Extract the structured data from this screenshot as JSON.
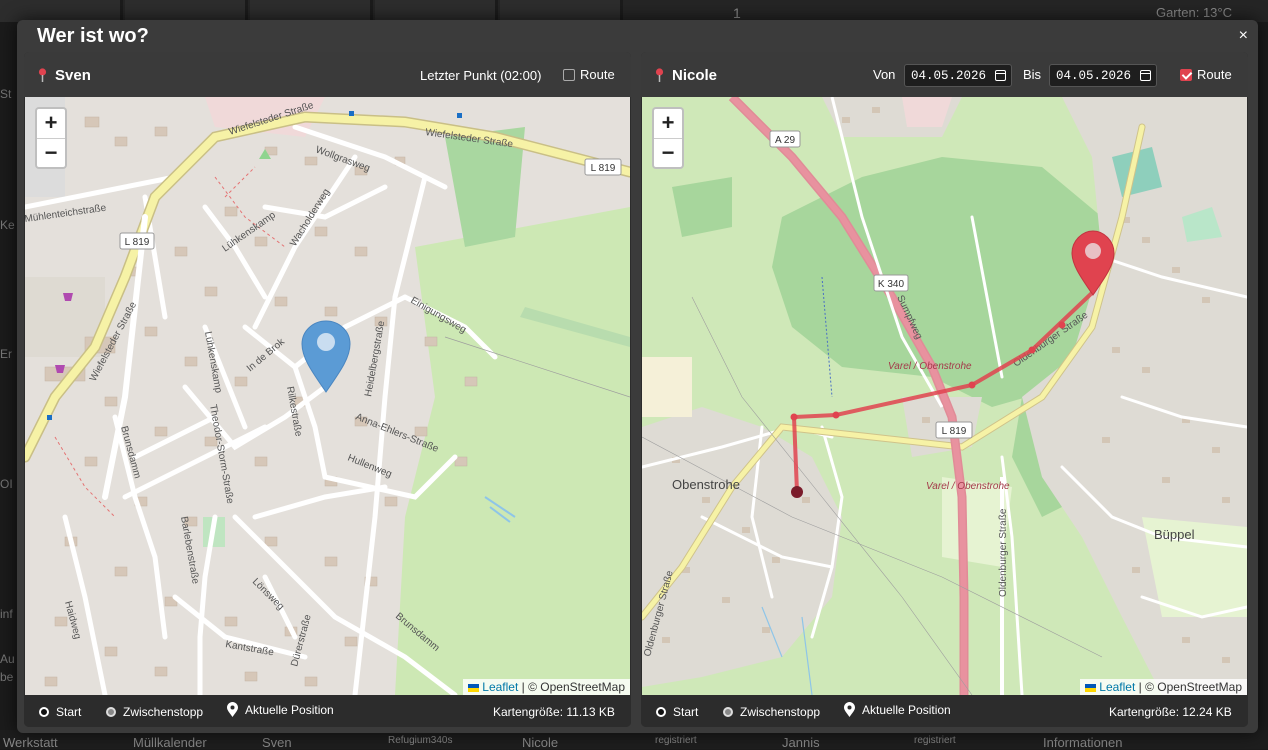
{
  "background": {
    "garden_label": "Garten:",
    "garden_temp": "13°C",
    "badge_count": "1",
    "left_fragments": [
      "St",
      "Ke",
      "Er",
      "OI",
      "inf",
      "Au",
      "be"
    ],
    "bottom_bar": [
      "Werkstatt",
      "Müllkalender",
      "Sven",
      "Refugium340s",
      "Nicole",
      "registriert",
      "Jannis",
      "registriert",
      "Informationen"
    ]
  },
  "modal": {
    "title": "Wer ist wo?",
    "close_symbol": "×"
  },
  "panels": [
    {
      "name": "Sven",
      "last_point": "Letzter Punkt (02:00)",
      "route_label": "Route",
      "route_checked": false,
      "map": {
        "streets": [
          "Wiefelsteder Straße",
          "Wiefelsteder Straße",
          "L 819",
          "L 819",
          "Wiefelsteder Straße",
          "Wollgrasweg",
          "Wacholderweg",
          "Lühkenskamp",
          "Lühkenskamp",
          "Mühlenteichstraße",
          "Einigungsweg",
          "Heidelbergstraße",
          "In de Brok",
          "Rilkestraße",
          "Anna-Ehlers-Straße",
          "Hullenweg",
          "Theodor-Storm-Straße",
          "Brunsdamm",
          "Barlebenstraße",
          "Lönsweg",
          "Dürerstraße",
          "Brunsdamm",
          "Kantstraße",
          "Haidweg"
        ],
        "marker_color": "#5b9bd5"
      },
      "attribution": {
        "leaflet": "Leaflet",
        "rest": "| © OpenStreetMap"
      },
      "footer": {
        "start": "Start",
        "mid": "Zwischenstopp",
        "current": "Aktuelle Position",
        "size": "Kartengröße: 11.13 KB"
      }
    },
    {
      "name": "Nicole",
      "from_label": "Von",
      "from_value": "04.05.2026",
      "to_label": "Bis",
      "to_value": "04.05.2026",
      "route_label": "Route",
      "route_checked": true,
      "map": {
        "labels": [
          "A 29",
          "K 340",
          "Sumpfweg",
          "Varel / Obenstrohe",
          "L 819",
          "Varel / Obenstrohe",
          "Obenstrohe",
          "Büppel",
          "Oldenburger Straße",
          "Oldenburger Straße",
          "Oldenburger Straße"
        ],
        "route_color": "#e0434f"
      },
      "attribution": {
        "leaflet": "Leaflet",
        "rest": "| © OpenStreetMap"
      },
      "footer": {
        "start": "Start",
        "mid": "Zwischenstopp",
        "current": "Aktuelle Position",
        "size": "Kartengröße: 12.24 KB"
      }
    }
  ]
}
